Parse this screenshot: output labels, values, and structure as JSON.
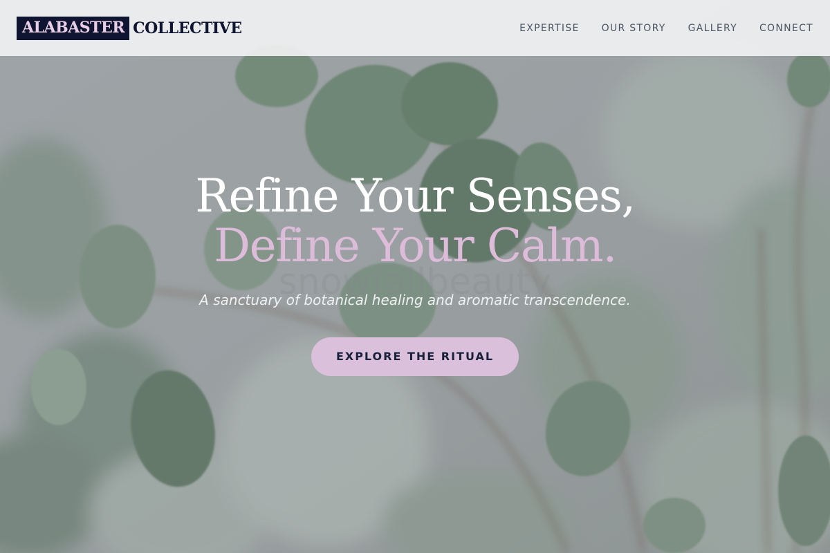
{
  "brand": {
    "logo_box": "ALABASTER",
    "logo_text": "COLLECTIVE"
  },
  "nav": {
    "items": [
      {
        "label": "EXPERTISE"
      },
      {
        "label": "OUR STORY"
      },
      {
        "label": "GALLERY"
      },
      {
        "label": "CONNECT"
      }
    ]
  },
  "hero": {
    "headline_line1": "Refine Your Senses,",
    "headline_line2": "Define Your Calm.",
    "watermark": "snowfallbeauty",
    "subtitle": "A sanctuary of botanical healing and aromatic transcendence.",
    "cta_label": "EXPLORE THE RITUAL"
  },
  "colors": {
    "header_bg": "#eeeff0",
    "brand_navy": "#0f1530",
    "accent_mauve": "#dbc0dc",
    "headline_white": "#ffffff",
    "headline_accent": "#dcbcd8"
  }
}
